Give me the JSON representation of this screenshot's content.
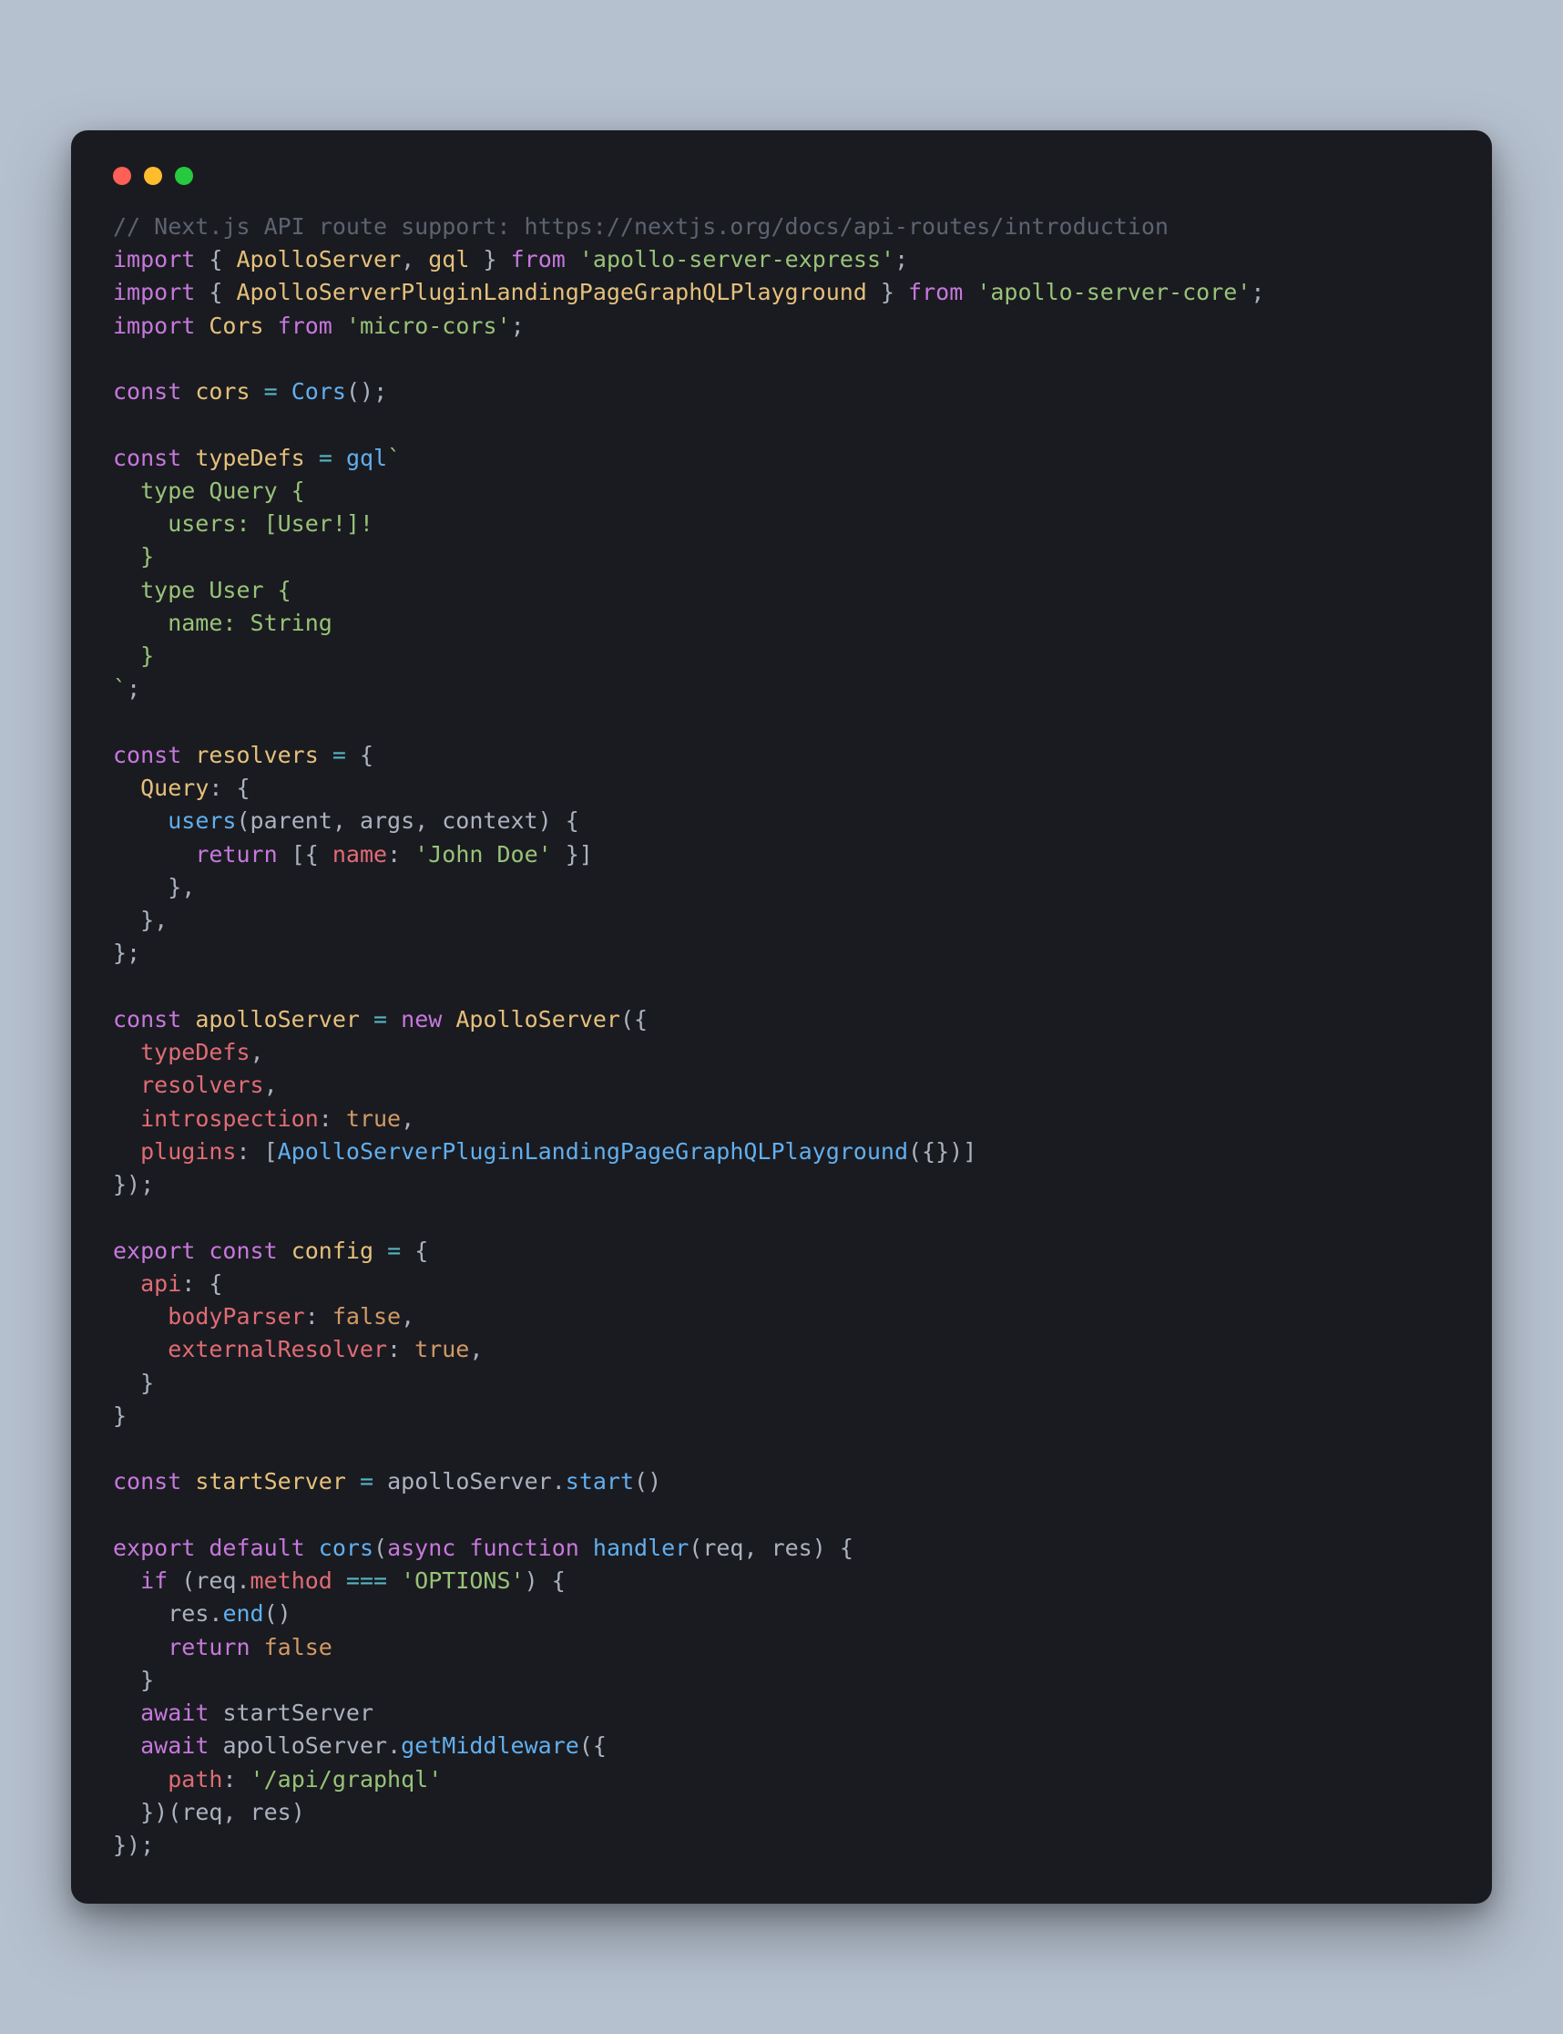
{
  "window": {
    "traffic": [
      "red",
      "yellow",
      "green"
    ]
  },
  "code": {
    "l1": {
      "comment": "// Next.js API route support: https://nextjs.org/docs/api-routes/introduction"
    },
    "l2": {
      "kw_import": "import",
      "brace_l": "{",
      "id1": "ApolloServer",
      "comma": ",",
      "id2": "gql",
      "brace_r": "}",
      "kw_from": "from",
      "str": "'apollo-server-express'",
      "semi": ";"
    },
    "l3": {
      "kw_import": "import",
      "brace_l": "{",
      "id": "ApolloServerPluginLandingPageGraphQLPlayground",
      "brace_r": "}",
      "kw_from": "from",
      "str": "'apollo-server-core'",
      "semi": ";"
    },
    "l4": {
      "kw_import": "import",
      "id": "Cors",
      "kw_from": "from",
      "str": "'micro-cors'",
      "semi": ";"
    },
    "l6": {
      "kw": "const",
      "name": "cors",
      "eq": "=",
      "call": "Cors",
      "paren": "()",
      "semi": ";"
    },
    "l8": {
      "kw": "const",
      "name": "typeDefs",
      "eq": "=",
      "tag": "gql",
      "tick": "`"
    },
    "l9": {
      "txt": "  type Query {"
    },
    "l10": {
      "txt": "    users: [User!]!"
    },
    "l11": {
      "txt": "  }"
    },
    "l12": {
      "txt": "  type User {"
    },
    "l13": {
      "txt": "    name: String"
    },
    "l14": {
      "txt": "  }"
    },
    "l15": {
      "tick": "`",
      "semi": ";"
    },
    "l17": {
      "kw": "const",
      "name": "resolvers",
      "eq": "=",
      "brace": "{"
    },
    "l18": {
      "prop": "Query",
      "colon": ":",
      "brace": "{"
    },
    "l19": {
      "fn": "users",
      "args": "(parent, args, context)",
      "brace": " {"
    },
    "l20": {
      "kw": "return",
      "open": " [{ ",
      "prop": "name",
      "colon": ": ",
      "str": "'John Doe'",
      "close": " }]"
    },
    "l21": {
      "txt": "    },"
    },
    "l22": {
      "txt": "  },"
    },
    "l23": {
      "txt": "};"
    },
    "l25": {
      "kw": "const",
      "name": "apolloServer",
      "eq": "=",
      "kw_new": "new",
      "cls": "ApolloServer",
      "open": "({"
    },
    "l26": {
      "prop": "typeDefs",
      "comma": ","
    },
    "l27": {
      "prop": "resolvers",
      "comma": ","
    },
    "l28": {
      "prop": "introspection",
      "colon": ": ",
      "val": "true",
      "comma": ","
    },
    "l29": {
      "prop": "plugins",
      "colon": ": ",
      "open": "[",
      "fn": "ApolloServerPluginLandingPageGraphQLPlayground",
      "args": "({})",
      "close": "]"
    },
    "l30": {
      "txt": "});"
    },
    "l32": {
      "kw_export": "export",
      "kw_const": "const",
      "name": "config",
      "eq": "=",
      "brace": "{"
    },
    "l33": {
      "prop": "api",
      "colon": ": ",
      "brace": "{"
    },
    "l34": {
      "prop": "bodyParser",
      "colon": ": ",
      "val": "false",
      "comma": ","
    },
    "l35": {
      "prop": "externalResolver",
      "colon": ": ",
      "val": "true",
      "comma": ","
    },
    "l36": {
      "txt": "  }"
    },
    "l37": {
      "txt": "}"
    },
    "l39": {
      "kw": "const",
      "name": "startServer",
      "eq": "=",
      "obj": "apolloServer",
      "dot": ".",
      "fn": "start",
      "paren": "()"
    },
    "l41": {
      "kw_export": "export",
      "kw_default": "default",
      "fn_cors": "cors",
      "paren_l": "(",
      "kw_async": "async",
      "kw_function": "function",
      "fn": "handler",
      "args_l": "(",
      "arg1": "req",
      "comma": ", ",
      "arg2": "res",
      "args_r": ")",
      "brace": " {"
    },
    "l42": {
      "kw_if": "if",
      "paren_l": " (",
      "obj": "req",
      "dot": ".",
      "prop": "method",
      "op": " === ",
      "str": "'OPTIONS'",
      "paren_r": ")",
      "brace": " {"
    },
    "l43": {
      "obj": "res",
      "dot": ".",
      "fn": "end",
      "paren": "()"
    },
    "l44": {
      "kw": "return",
      "sp": " ",
      "val": "false"
    },
    "l45": {
      "txt": "  }"
    },
    "l46": {
      "kw": "await",
      "sp": " ",
      "id": "startServer"
    },
    "l47": {
      "kw": "await",
      "sp": " ",
      "obj": "apolloServer",
      "dot": ".",
      "fn": "getMiddleware",
      "open": "({"
    },
    "l48": {
      "prop": "path",
      "colon": ": ",
      "str": "'/api/graphql'"
    },
    "l49": {
      "close": "})(",
      "arg1": "req",
      "comma": ", ",
      "arg2": "res",
      "paren_r": ")"
    },
    "l50": {
      "txt": "});"
    }
  }
}
